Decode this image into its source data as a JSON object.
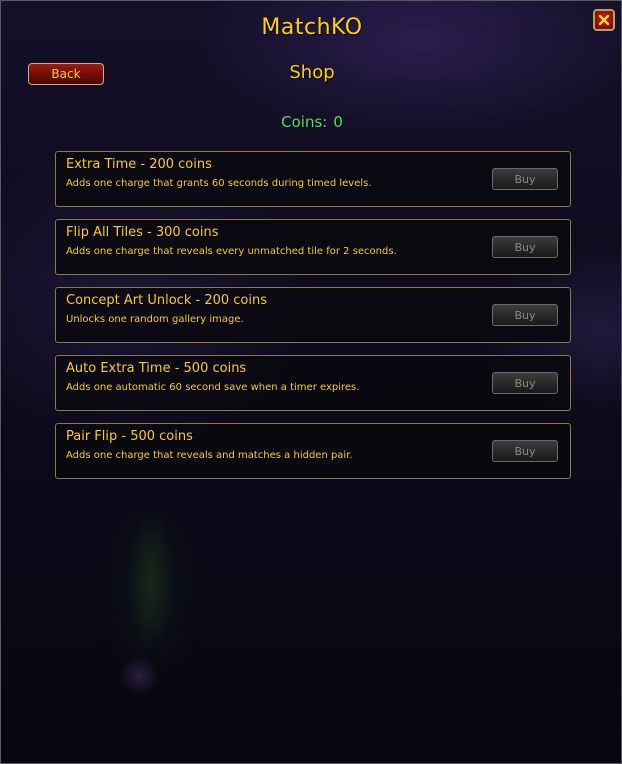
{
  "window": {
    "title": "MatchKO",
    "subtitle": "Shop"
  },
  "header": {
    "back_label": "Back",
    "close_icon": "close-x-icon"
  },
  "coins": {
    "label": "Coins:",
    "value": "0"
  },
  "shop_items": [
    {
      "title": "Extra Time - 200 coins",
      "description": "Adds one charge that grants 60 seconds during timed levels.",
      "button_label": "Buy"
    },
    {
      "title": "Flip All Tiles - 300 coins",
      "description": "Adds one charge that reveals every unmatched tile for 2 seconds.",
      "button_label": "Buy"
    },
    {
      "title": "Concept Art Unlock - 200 coins",
      "description": "Unlocks one random gallery image.",
      "button_label": "Buy"
    },
    {
      "title": "Auto Extra Time - 500 coins",
      "description": "Adds one automatic 60 second save when a timer expires.",
      "button_label": "Buy"
    },
    {
      "title": "Pair Flip - 500 coins",
      "description": "Adds one charge that reveals and matches a hidden pair.",
      "button_label": "Buy"
    }
  ],
  "colors": {
    "gold_text": "#ffd100",
    "coins_green": "#3ee85a",
    "disabled_text": "#8a8a8a"
  }
}
